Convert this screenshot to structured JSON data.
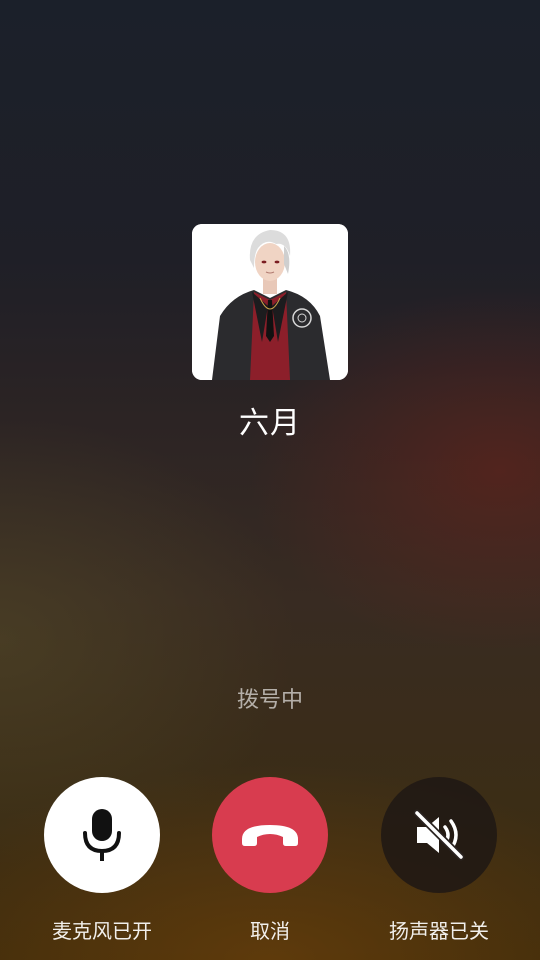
{
  "caller": {
    "name": "六月",
    "avatar_icon": "contact-avatar-portrait"
  },
  "call": {
    "status": "拨号中"
  },
  "controls": {
    "microphone": {
      "label": "麦克风已开",
      "icon": "microphone-icon",
      "state": "on"
    },
    "cancel": {
      "label": "取消",
      "icon": "hang-up-icon",
      "color": "#d83c4f"
    },
    "speaker": {
      "label": "扬声器已关",
      "icon": "speaker-muted-icon",
      "state": "off"
    }
  }
}
